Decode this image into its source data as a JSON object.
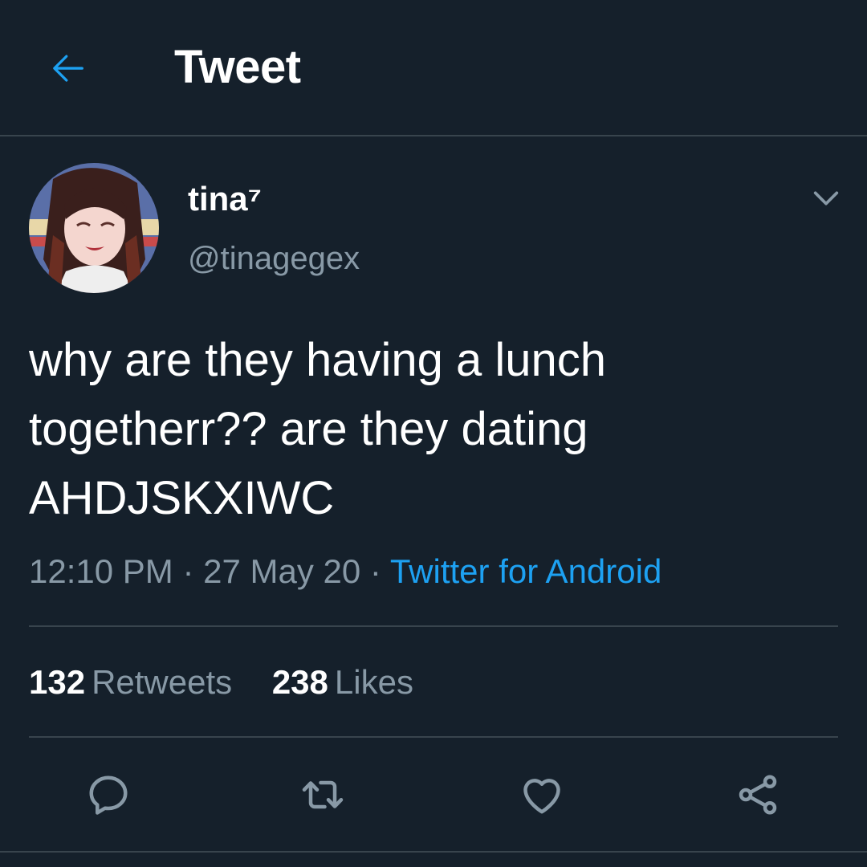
{
  "header": {
    "title": "Tweet",
    "back_icon": "arrow-left-icon"
  },
  "author": {
    "display_name": "tina⁷",
    "handle": "@tinagegex",
    "avatar_icon": "avatar-anime-character"
  },
  "tweet": {
    "text": "why are they having a lunch\ntogetherr?? are they dating\nAHDJSKXIWC",
    "time": "12:10 PM",
    "date": "27 May 20",
    "source": "Twitter for Android",
    "separator": "·"
  },
  "stats": {
    "retweets_count": "132",
    "retweets_label": "Retweets",
    "likes_count": "238",
    "likes_label": "Likes"
  },
  "actions": [
    "reply-icon",
    "retweet-icon",
    "like-icon",
    "share-icon"
  ],
  "colors": {
    "background": "#15202b",
    "divider": "#38444d",
    "secondary_text": "#8899a6",
    "accent": "#1da1f2",
    "primary_text": "#ffffff"
  }
}
